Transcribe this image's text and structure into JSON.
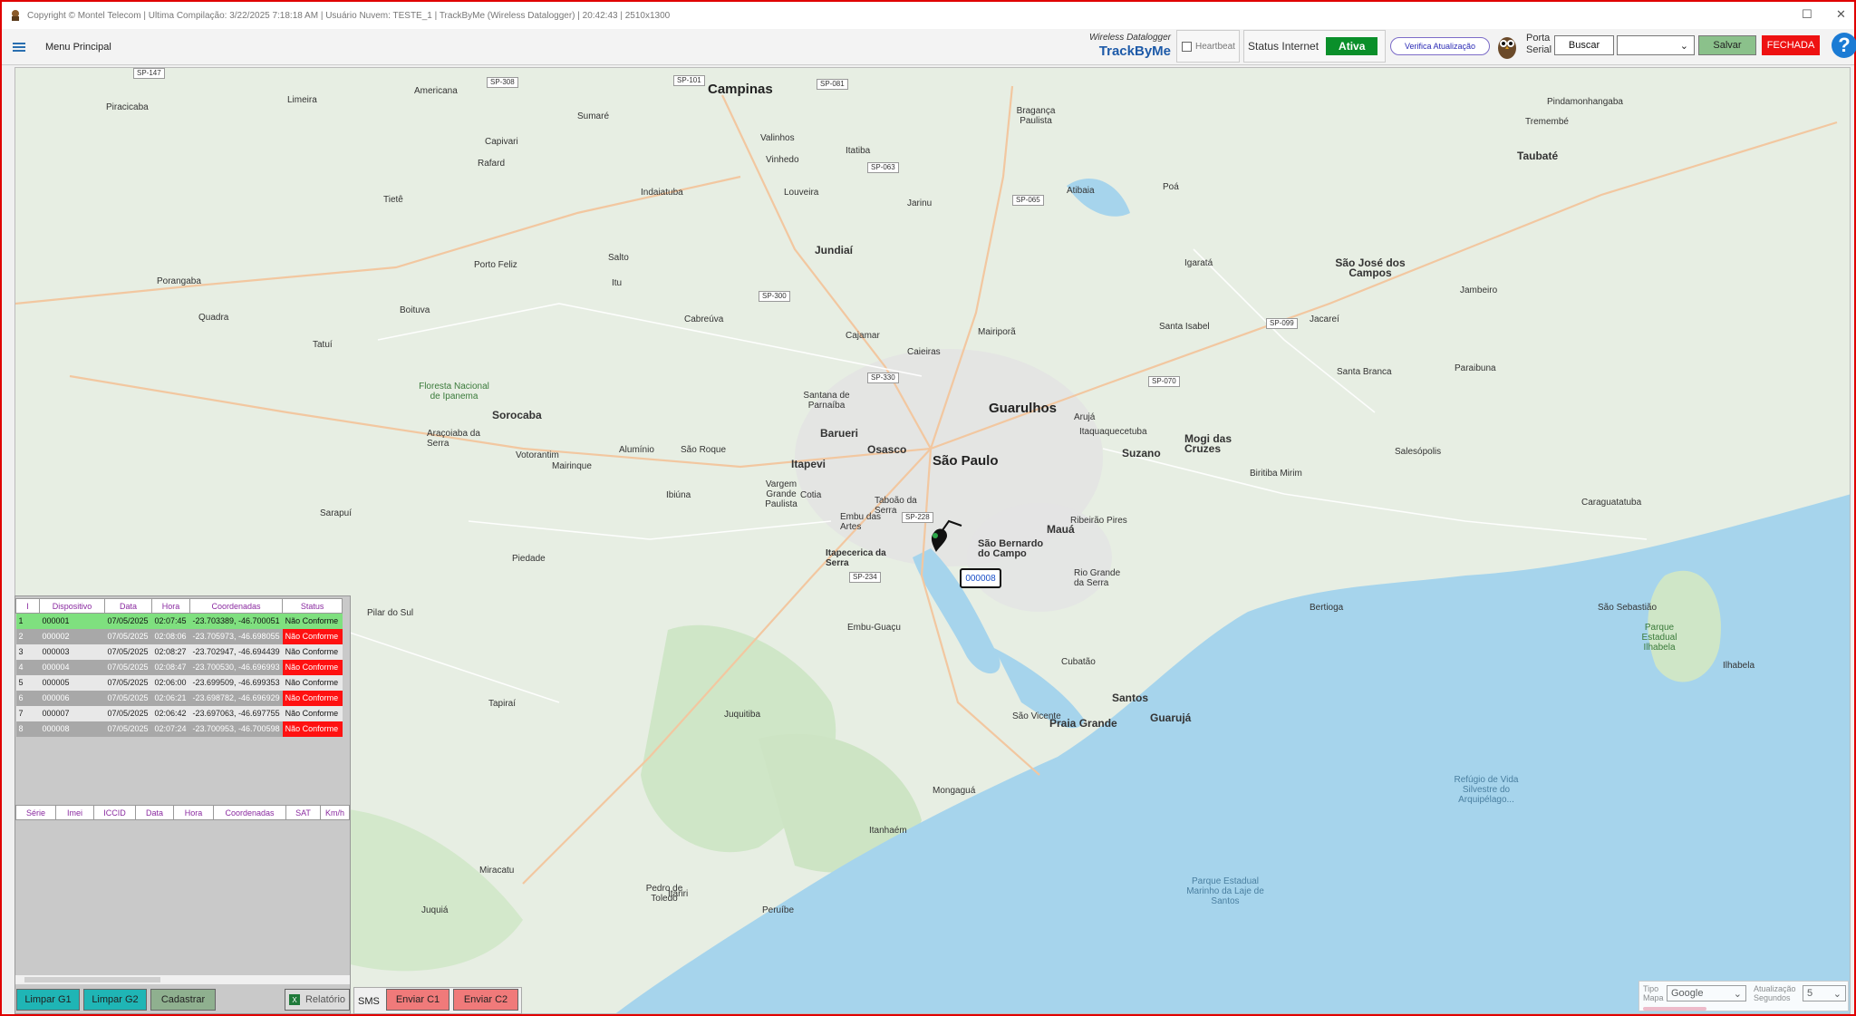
{
  "window": {
    "title": "Copyright © Montel Telecom | Ultima Compilação: 3/22/2025 7:18:18 AM | Usuário Nuvem: TESTE_1 | TrackByMe (Wireless Datalogger) | 20:42:43 | 2510x1300"
  },
  "toolbar": {
    "menu_label": "Menu Principal",
    "brand_sub": "Wireless Datalogger",
    "brand_main": "TrackByMe",
    "heartbeat_label": "Heartbeat",
    "internet_label": "Status Internet",
    "internet_status": "Ativa",
    "update_label": "Verifica Atualização",
    "port_label_1": "Porta",
    "port_label_2": "Serial",
    "buscar_label": "Buscar",
    "port_value": "",
    "salvar_label": "Salvar",
    "fechada_label": "FECHADA",
    "help_label": "?"
  },
  "devices": {
    "headers": [
      "I",
      "Dispositivo",
      "Data",
      "Hora",
      "Coordenadas",
      "Status"
    ],
    "rows": [
      {
        "i": "1",
        "id": "000001",
        "date": "07/05/2025",
        "time": "02:07:45",
        "coords": "-23.703389, -46.700051",
        "status": "Não Conforme"
      },
      {
        "i": "2",
        "id": "000002",
        "date": "07/05/2025",
        "time": "02:08:06",
        "coords": "-23.705973, -46.698055",
        "status": "Não Conforme"
      },
      {
        "i": "3",
        "id": "000003",
        "date": "07/05/2025",
        "time": "02:08:27",
        "coords": "-23.702947, -46.694439",
        "status": "Não Conforme"
      },
      {
        "i": "4",
        "id": "000004",
        "date": "07/05/2025",
        "time": "02:08:47",
        "coords": "-23.700530, -46.696993",
        "status": "Não Conforme"
      },
      {
        "i": "5",
        "id": "000005",
        "date": "07/05/2025",
        "time": "02:06:00",
        "coords": "-23.699509, -46.699353",
        "status": "Não Conforme"
      },
      {
        "i": "6",
        "id": "000006",
        "date": "07/05/2025",
        "time": "02:06:21",
        "coords": "-23.698782, -46.696929",
        "status": "Não Conforme"
      },
      {
        "i": "7",
        "id": "000007",
        "date": "07/05/2025",
        "time": "02:06:42",
        "coords": "-23.697063, -46.697755",
        "status": "Não Conforme"
      },
      {
        "i": "8",
        "id": "000008",
        "date": "07/05/2025",
        "time": "02:07:24",
        "coords": "-23.700953, -46.700598",
        "status": "Não Conforme"
      }
    ]
  },
  "detail": {
    "headers": [
      "Série",
      "Imei",
      "ICCID",
      "Data",
      "Hora",
      "Coordenadas",
      "SAT",
      "Km/h"
    ]
  },
  "buttons": {
    "limpar_g1": "Limpar G1",
    "limpar_g2": "Limpar G2",
    "cadastrar": "Cadastrar",
    "relatorio": "Relatório",
    "sms": "SMS",
    "enviar_c1": "Enviar C1",
    "enviar_c2": "Enviar C2"
  },
  "map_controls": {
    "tipo_label_1": "Tipo",
    "tipo_label_2": "Mapa",
    "tipo_value": "Google",
    "atual_label_1": "Atualização",
    "atual_label_2": "Segundos",
    "atual_value": "5"
  },
  "map": {
    "marker_label": "000008",
    "places_big": [
      "Campinas",
      "São Paulo",
      "Guarulhos"
    ],
    "places_med": [
      "Jundiaí",
      "Sorocaba",
      "Barueri",
      "Osasco",
      "Itapevi",
      "Mauá",
      "Santos",
      "Taubaté",
      "Suzano",
      "Mogi das Cruzes",
      "São José dos Campos",
      "Praia Grande",
      "Guarujá",
      "São Bernardo do Campo",
      "Itapecerica da Serra",
      "Taboão da Serra",
      "Embu das Artes",
      "Jacareí",
      "Cotia"
    ],
    "places": [
      "Piracicaba",
      "Limeira",
      "Americana",
      "Sumaré",
      "Indaiatuba",
      "Itu",
      "Salto",
      "Louveira",
      "Vinhedo",
      "Valinhos",
      "Itatiba",
      "Bragança Paulista",
      "Atibaia",
      "Mairiporã",
      "Caieiras",
      "Cajamar",
      "Santana de Parnaíba",
      "Vargem Grande Paulista",
      "Ibiúna",
      "Piedade",
      "Juquitiba",
      "Embu-Guaçu",
      "Cubatão",
      "São Vicente",
      "Mongaguá",
      "Itanhaém",
      "Peruíbe",
      "Bertioga",
      "Caraguatatuba",
      "São Sebastião",
      "Ilhabela",
      "Paraibuna",
      "Santa Branca",
      "Salesópolis",
      "Biritiba Mirim",
      "Pindamonhangaba",
      "Tremembé",
      "Jambeiro",
      "Boituva",
      "Tatuí",
      "Porto Feliz",
      "Araçoiaba da Serra",
      "Votorantim",
      "Mairinque",
      "Alumínio",
      "São Roque",
      "Cabreúva",
      "Jarinu",
      "Igaratá",
      "Santa Isabel",
      "Arujá",
      "Itaquaquecetuba",
      "Poá",
      "Ribeirão Pires",
      "Rio Grande da Serra",
      "Tietê",
      "Capivari",
      "Rafard",
      "Porangaba",
      "Quadra",
      "Sarapuí",
      "Pilar do Sul",
      "Tapiraí",
      "Juquiá",
      "Miracatu",
      "Pedro de Toledo",
      "Itariri"
    ],
    "parks": [
      "Floresta Nacional de Ipanema",
      "Parque Estadual Ilhabela"
    ],
    "sea_labels": [
      "Refúgio de Vida Silvestre do Arquipélago...",
      "Parque Estadual Marinho da Laje de Santos"
    ]
  }
}
